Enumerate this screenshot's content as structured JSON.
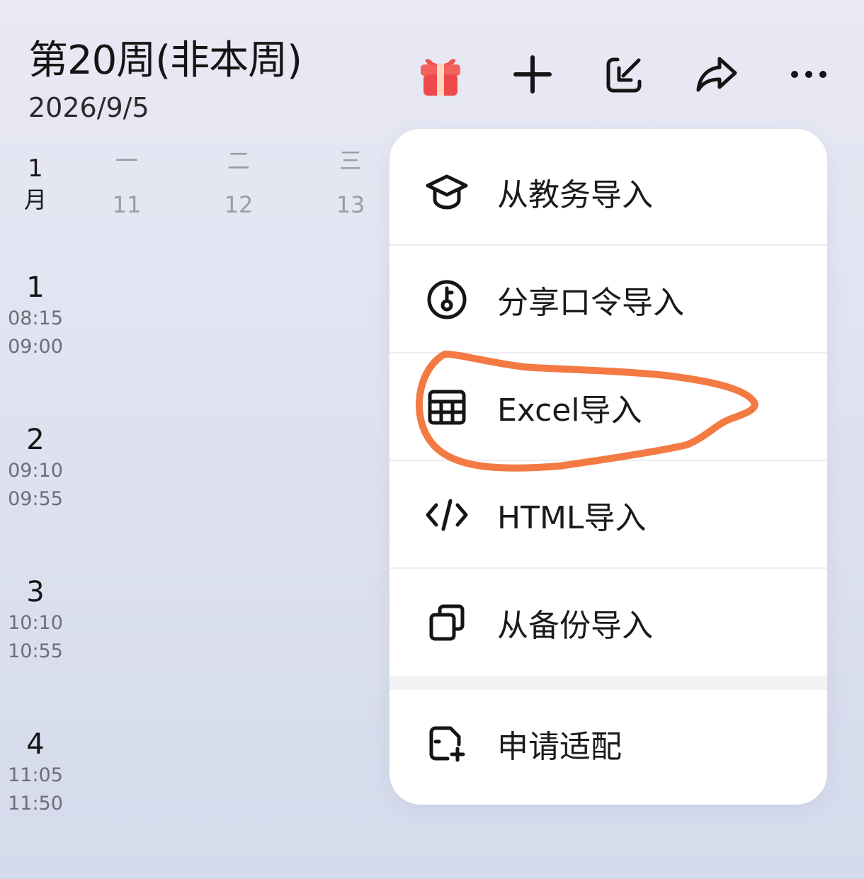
{
  "header": {
    "title": "第20周(非本周)",
    "date": "2026/9/5"
  },
  "toolbar": {
    "gift": "gift-icon",
    "add": "plus-icon",
    "import": "import-icon",
    "share": "share-icon",
    "more": "more-icon"
  },
  "calendar": {
    "month_num": "1",
    "month_label": "月",
    "days": [
      {
        "weekday": "一",
        "date": "11"
      },
      {
        "weekday": "二",
        "date": "12"
      },
      {
        "weekday": "三",
        "date": "13"
      }
    ],
    "periods": [
      {
        "num": "1",
        "start": "08:15",
        "end": "09:00"
      },
      {
        "num": "2",
        "start": "09:10",
        "end": "09:55"
      },
      {
        "num": "3",
        "start": "10:10",
        "end": "10:55"
      },
      {
        "num": "4",
        "start": "11:05",
        "end": "11:50"
      }
    ]
  },
  "menu": {
    "items": [
      {
        "label": "从教务导入",
        "icon": "graduation-cap-icon"
      },
      {
        "label": "分享口令导入",
        "icon": "key-circle-icon"
      },
      {
        "label": "Excel导入",
        "icon": "table-icon"
      },
      {
        "label": "HTML导入",
        "icon": "code-icon"
      },
      {
        "label": "从备份导入",
        "icon": "copy-icon"
      },
      {
        "label": "申请适配",
        "icon": "file-plus-icon"
      }
    ]
  },
  "colors": {
    "accent_annotation": "#f47a44",
    "gift_red": "#f0504f",
    "gift_ribbon": "#ffd7c0"
  }
}
